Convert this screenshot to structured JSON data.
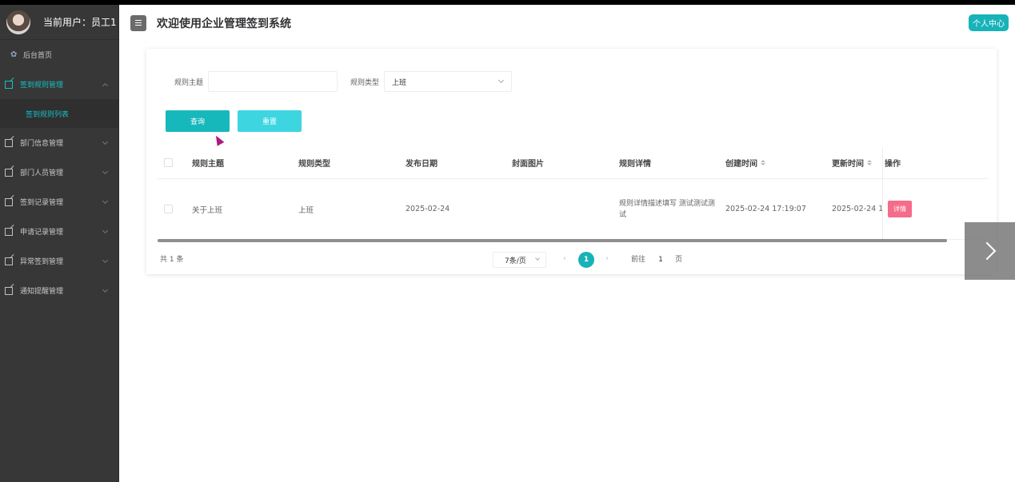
{
  "user": {
    "label": "当前用户：员工1"
  },
  "sidebar": {
    "home": {
      "label": "后台首页"
    },
    "items": [
      {
        "label": "签到规则管理"
      },
      {
        "label": "部门信息管理"
      },
      {
        "label": "部门人员管理"
      },
      {
        "label": "签到记录管理"
      },
      {
        "label": "申请记录管理"
      },
      {
        "label": "异常签到管理"
      },
      {
        "label": "通知提醒管理"
      }
    ],
    "submenu": [
      {
        "label": "签到规则列表"
      }
    ]
  },
  "header": {
    "title": "欢迎使用企业管理签到系统",
    "profile_label": "个人中心"
  },
  "search": {
    "subject_label": "规则主题",
    "subject_value": "",
    "type_label": "规则类型",
    "type_value": "上班",
    "query_label": "查询",
    "reset_label": "重置"
  },
  "table": {
    "headers": {
      "subject": "规则主题",
      "type": "规则类型",
      "date": "发布日期",
      "cover": "封面图片",
      "detail": "规则详情",
      "created": "创建时间",
      "updated": "更新时间",
      "actions": "操作"
    },
    "rows": [
      {
        "subject": "关于上班",
        "type": "上班",
        "date": "2025-02-24",
        "cover": "",
        "detail": "规则详情描述填写 测试测试测试",
        "created": "2025-02-24 17:19:07",
        "updated": "2025-02-24 1",
        "action_label": "详情"
      }
    ]
  },
  "pagination": {
    "total": "共 1 条",
    "page_size": "7条/页",
    "current_page": "1",
    "goto_label": "前往",
    "goto_value": "1",
    "goto_suffix": "页"
  },
  "colors": {
    "accent": "#17b3b8",
    "sidebar_bg": "#373737",
    "detail_button": "#f56c8a"
  }
}
